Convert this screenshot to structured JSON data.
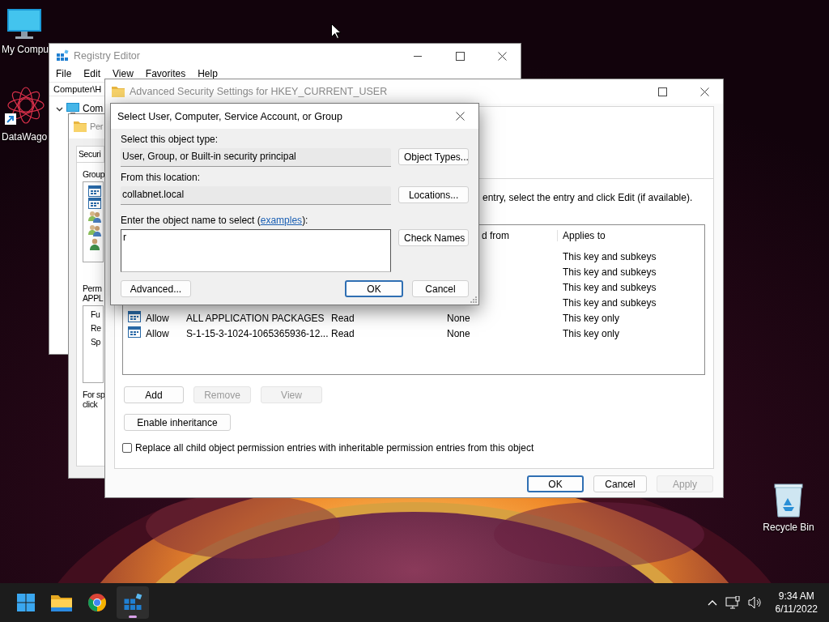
{
  "desktop_icons": [
    {
      "kind": "computer",
      "label": "My Compu"
    },
    {
      "kind": "shortcut",
      "label": "DataWago"
    },
    {
      "kind": "recycle-bin",
      "label": "Recycle Bin"
    }
  ],
  "registry_editor": {
    "title": "Registry Editor",
    "menu": [
      "File",
      "Edit",
      "View",
      "Favorites",
      "Help"
    ],
    "address": "Computer\\H",
    "tree": [
      {
        "label": "Com",
        "expanded": true
      }
    ]
  },
  "permissions_window": {
    "title": "Per",
    "tabs": [
      {
        "label": "Securi",
        "selected": true
      }
    ],
    "group_label": "Group",
    "principals": [
      {
        "kind": "package"
      },
      {
        "kind": "package"
      },
      {
        "kind": "group"
      },
      {
        "kind": "group"
      },
      {
        "kind": "user"
      }
    ],
    "permissions_label": [
      "Perm",
      "APPL"
    ],
    "permissions": [
      "Fu",
      "Re",
      "Sp"
    ],
    "note": [
      "For sp",
      "click"
    ]
  },
  "advanced_security": {
    "title": "Advanced Security Settings for HKEY_CURRENT_USER",
    "hint": "entry, select the entry and click Edit (if available).",
    "columns": [
      "d from",
      "Applies to"
    ],
    "rows": [
      {
        "applies_to": "This key and subkeys"
      },
      {
        "applies_to": "This key and subkeys"
      },
      {
        "applies_to": "This key and subkeys"
      },
      {
        "applies_to": "This key and subkeys"
      },
      {
        "type": "Allow",
        "principal": "ALL APPLICATION PACKAGES",
        "access": "Read",
        "inherited": "None",
        "applies_to": "This key only"
      },
      {
        "type": "Allow",
        "principal": "S-1-15-3-1024-1065365936-12...",
        "access": "Read",
        "inherited": "None",
        "applies_to": "This key only"
      }
    ],
    "buttons": [
      {
        "label": "Add",
        "disabled": false
      },
      {
        "label": "Remove",
        "disabled": true
      },
      {
        "label": "View",
        "disabled": true
      }
    ],
    "inheritance_button": "Enable inheritance",
    "replace_entries": {
      "label": "Replace all child object permission entries with inheritable permission entries from this object",
      "checked": false
    },
    "footer_buttons": [
      {
        "label": "OK",
        "disabled": false,
        "default": true
      },
      {
        "label": "Cancel",
        "disabled": false,
        "default": false
      },
      {
        "label": "Apply",
        "disabled": true,
        "default": false
      }
    ]
  },
  "select_dialog": {
    "title": "Select User, Computer, Service Account, or Group",
    "object_type_label": "Select this object type:",
    "object_type": "User, Group, or Built-in security principal",
    "object_types_button": "Object Types...",
    "location_label": "From this location:",
    "location": "collabnet.local",
    "locations_button": "Locations...",
    "name_label_start": "Enter the object name to select (",
    "examples_link": "examples",
    "name_label_end": "):",
    "name_value": "r",
    "check_names_button": "Check Names",
    "advanced_button": "Advanced...",
    "buttons": [
      {
        "label": "OK",
        "default": true
      },
      {
        "label": "Cancel",
        "default": false
      }
    ]
  },
  "taskbar": {
    "apps": [
      {
        "kind": "start",
        "active": false
      },
      {
        "kind": "folder",
        "active": false
      },
      {
        "kind": "browser",
        "active": false
      },
      {
        "kind": "registry",
        "active": true
      }
    ],
    "time": "9:34 AM",
    "date": "6/11/2022"
  }
}
